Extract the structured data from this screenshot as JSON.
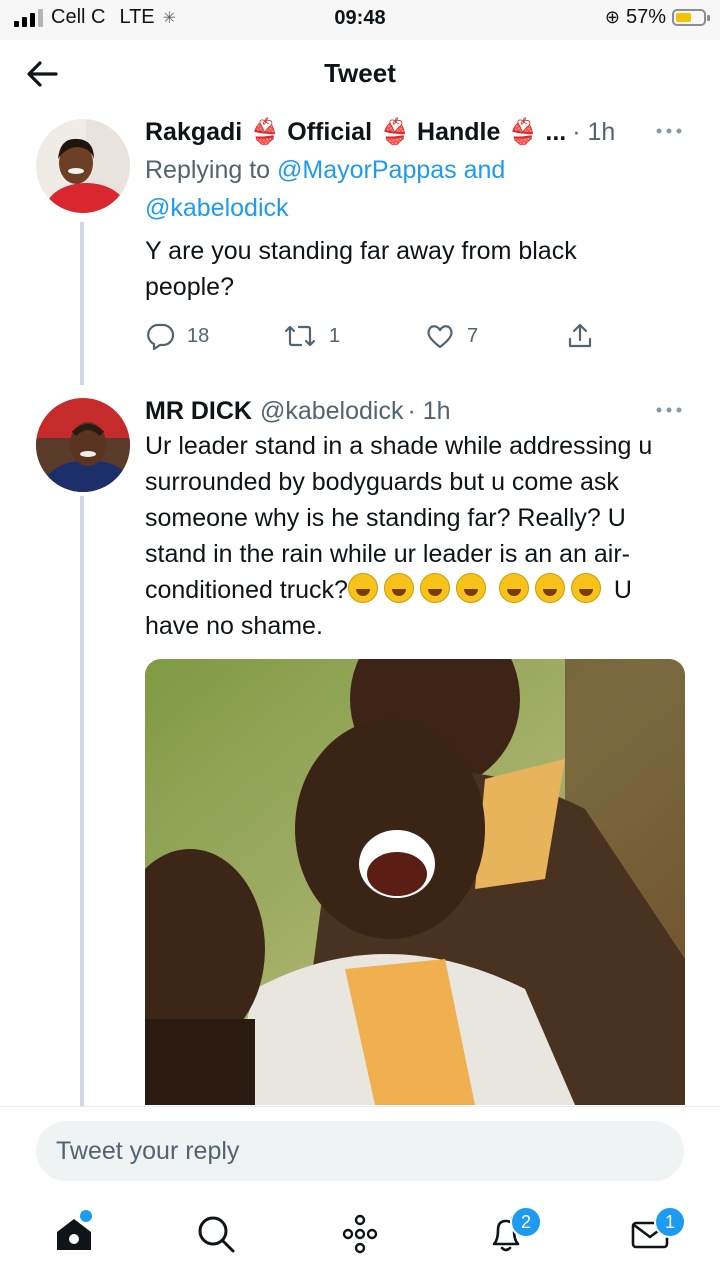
{
  "status_bar": {
    "carrier": "Cell C",
    "network": "LTE",
    "time": "09:48",
    "battery": "57%",
    "battery_level": 0.57
  },
  "header": {
    "title": "Tweet",
    "back_icon": "arrow-left-icon"
  },
  "tweets": [
    {
      "name": "Rakgadi 👙 Official 👙 Handle 👙 ...",
      "time": "· 1h",
      "reply_prefix": "Replying to",
      "reply_handle_1": "@MayorPappas",
      "reply_and": "and",
      "reply_handle_2": "@kabelodick",
      "text": "Y are you standing far away from black people?",
      "replies": "18",
      "retweets": "1",
      "likes": "7"
    },
    {
      "name": "MR DICK",
      "handle": "@kabelodick",
      "time": "· 1h",
      "text": "Ur leader stand in a shade while addressing u surrounded by bodyguards but u come ask someone why is he standing far? Really? U stand in the rain while ur leader is an an air-conditioned truck?",
      "text_tail": "U have no shame."
    }
  ],
  "reply_box": {
    "placeholder": "Tweet your reply"
  },
  "tab_bar": {
    "notifications_badge": "2",
    "messages_badge": "1"
  },
  "colors": {
    "accent": "#1d9bf0",
    "muted": "#536471",
    "text": "#0f1419"
  }
}
